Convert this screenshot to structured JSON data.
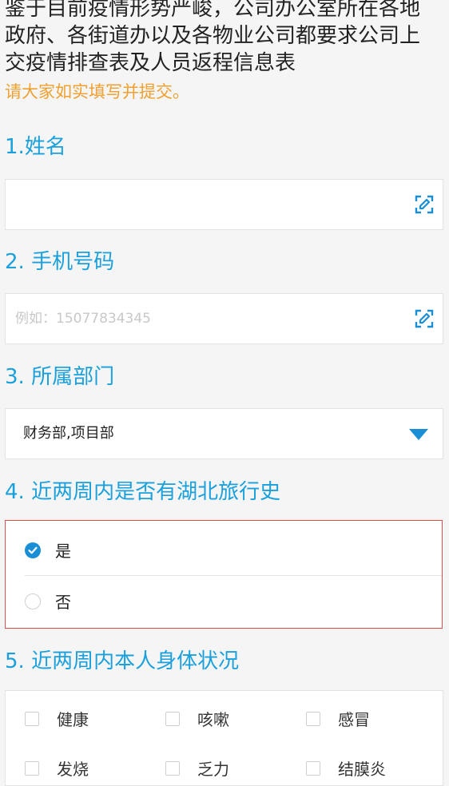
{
  "intro": {
    "text": "鉴于目前疫情形势严峻，公司办公室所在各地政府、各街道办以及各物业公司都要求公司上交疫情排查表及人员返程信息表",
    "note": "请大家如实填写并提交。"
  },
  "questions": {
    "name": {
      "title": "1.姓名",
      "value": "",
      "placeholder": ""
    },
    "phone": {
      "title": "2. 手机号码",
      "value": "",
      "placeholder": "例如：15077834345"
    },
    "department": {
      "title": "3. 所属部门",
      "selected": "财务部,项目部"
    },
    "hubei_travel": {
      "title": "4. 近两周内是否有湖北旅行史",
      "options": [
        {
          "label": "是",
          "checked": true
        },
        {
          "label": "否",
          "checked": false
        }
      ]
    },
    "health": {
      "title": "5. 近两周内本人身体状况",
      "options": [
        {
          "label": "健康",
          "checked": false
        },
        {
          "label": "咳嗽",
          "checked": false
        },
        {
          "label": "感冒",
          "checked": false
        },
        {
          "label": "发烧",
          "checked": false
        },
        {
          "label": "乏力",
          "checked": false
        },
        {
          "label": "结膜炎",
          "checked": false
        }
      ]
    }
  },
  "colors": {
    "accent": "#1aa0dc",
    "note": "#f0a030",
    "error_border": "#e34a4a"
  }
}
